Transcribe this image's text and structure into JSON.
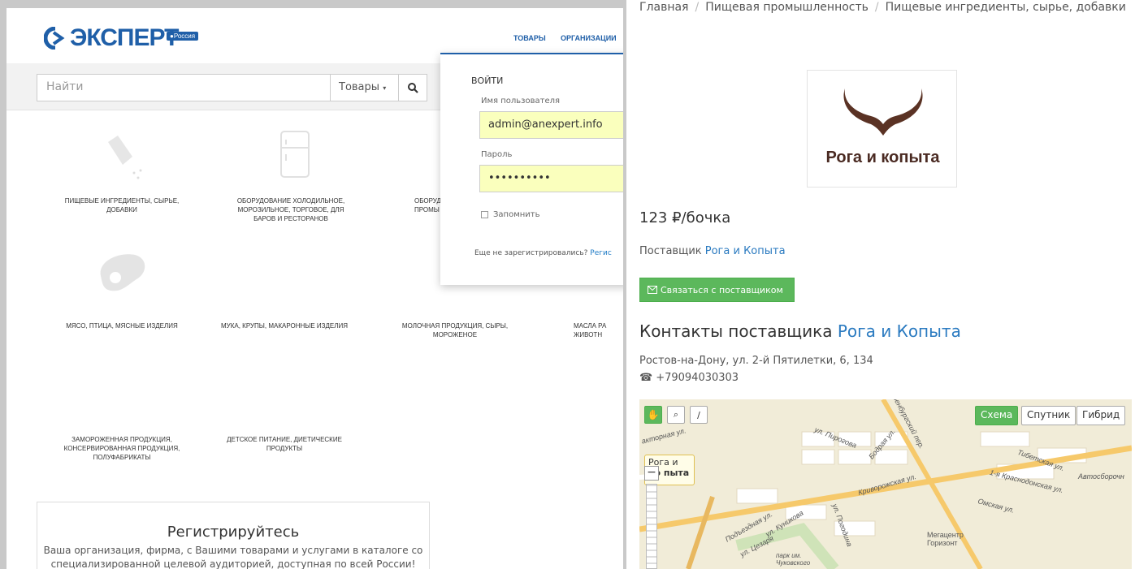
{
  "left": {
    "logo": "ЭКСПЕРТ",
    "region": "Россия",
    "nav": [
      "ТОВАРЫ",
      "ОРГАНИЗАЦИИ"
    ],
    "search": {
      "placeholder": "Найти",
      "scope": "Товары"
    },
    "categories": [
      "ПИЩЕВЫЕ ИНГРЕДИЕНТЫ, СЫРЬЕ, ДОБАВКИ",
      "ОБОРУДОВАНИЕ ХОЛОДИЛЬНОЕ, МОРОЗИЛЬНОЕ, ТОРГОВОЕ, ДЛЯ БАРОВ И РЕСТОРАНОВ",
      "ОБОРУД ПРОМЫ",
      "МЯСО, ПТИЦА, МЯСНЫЕ ИЗДЕЛИЯ",
      "МУКА, КРУПЫ, МАКАРОННЫЕ ИЗДЕЛИЯ",
      "МОЛОЧНАЯ ПРОДУКЦИЯ, СЫРЫ, МОРОЖЕНОЕ",
      "МАСЛА РА ЖИВОТН",
      "ЗАМОРОЖЕННАЯ ПРОДУКЦИЯ, КОНСЕРВИРОВАННАЯ ПРОДУКЦИЯ, ПОЛУФАБРИКАТЫ",
      "ДЕТСКОЕ ПИТАНИЕ, ДИЕТИЧЕСКИЕ ПРОДУКТЫ"
    ],
    "register": {
      "title": "Регистрируйтесь",
      "text1": "Ваша организация, фирма, с Вашими товарами и услугами в каталоге со",
      "text2": "специализированной целевой аудиторией, доступная по всей России!"
    },
    "login": {
      "title": "ВОЙТИ",
      "user_label": "Имя пользователя",
      "user_value": "admin@anexpert.info",
      "pass_label": "Пароль",
      "pass_value": "••••••••••",
      "remember": "Запомнить",
      "not_registered": "Еще не зарегистрировались?",
      "register_link": "Регис"
    }
  },
  "right": {
    "breadcrumb": [
      "Главная",
      "Пищевая промышленность",
      "Пищевые ингредиенты, сырье, добавки"
    ],
    "logo_text": "Рога и копыта",
    "price": "123 ₽/бочка",
    "supplier_label": "Поставщик",
    "supplier_name": "Рога и Копыта",
    "contact_button": "Связаться с поставщиком",
    "contacts_title": "Контакты поставщика",
    "contacts_company": "Рога и Копыта",
    "address": "Ростов-на-Дону, ул. 2-й Пятилетки, 6, 134",
    "phone": "+79094030303",
    "map": {
      "buttons": [
        "Схема",
        "Спутник",
        "Гибрид"
      ],
      "active": "Схема",
      "balloon": "Рога и",
      "balloon2": "ко пыта",
      "streets": [
        "ул. Пирогова",
        "Бодрая ул.",
        "Оренбургский пер.",
        "Криворожская ул.",
        "Тибетская ул.",
        "1-я Краснодонская ул.",
        "Омская ул.",
        "Подъездная ул.",
        "ул. Куникова",
        "ул. Погодина",
        "ул. Цезаря",
        "парк им. Чуковского",
        "Мегацентр Горизонт",
        "Автосборочн",
        "акторная ул."
      ]
    }
  }
}
